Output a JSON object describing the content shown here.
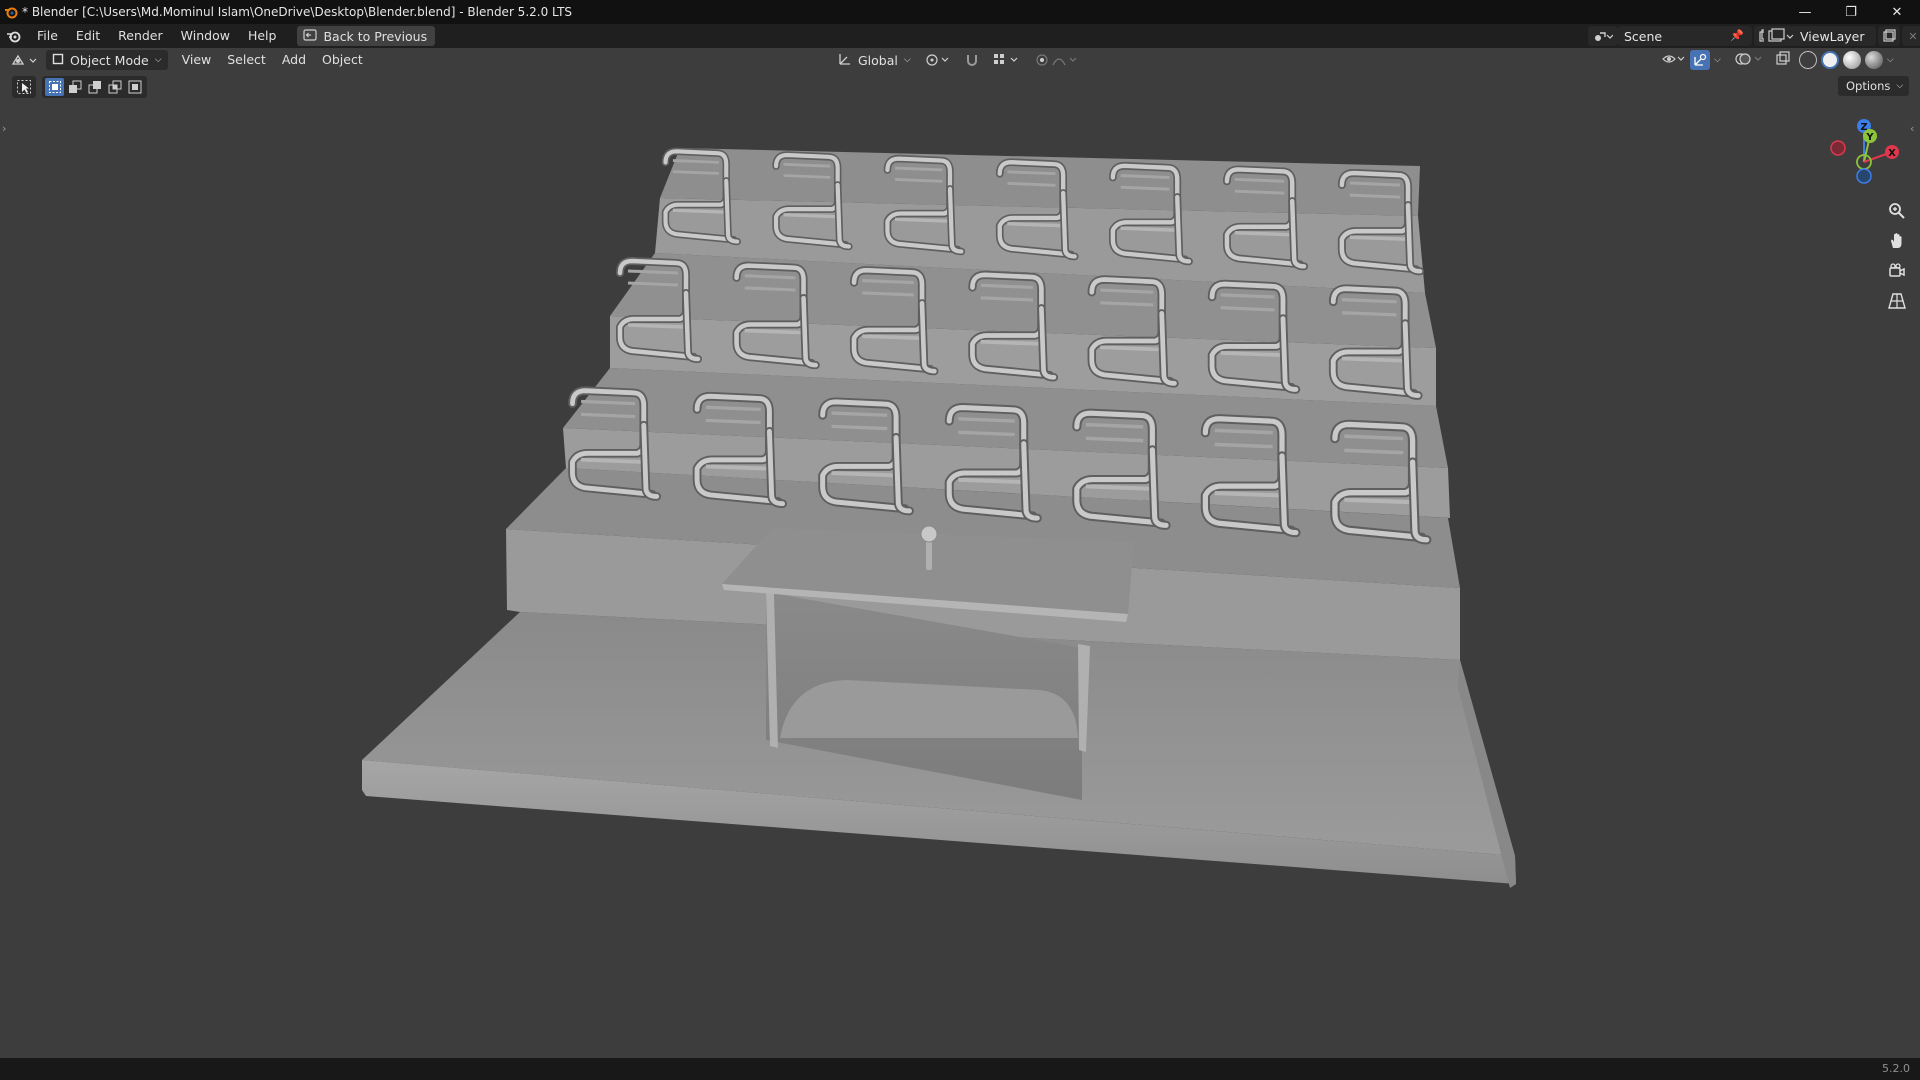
{
  "window": {
    "title": "* Blender [C:\\Users\\Md.Mominul Islam\\OneDrive\\Desktop\\Blender.blend] - Blender 5.2.0 LTS",
    "controls": [
      "minimize-icon",
      "restore-icon",
      "close-icon"
    ]
  },
  "menubar": {
    "items": [
      "File",
      "Edit",
      "Render",
      "Window",
      "Help"
    ],
    "back_button": "Back to Previous",
    "scene_label": "Scene",
    "view_layer_label": "ViewLayer"
  },
  "viewport_header": {
    "mode": "Object Mode",
    "menus": [
      "View",
      "Select",
      "Add",
      "Object"
    ],
    "transform_orientation": "Global",
    "options_label": "Options"
  },
  "gizmo": {
    "axes": [
      "Z",
      "Y",
      "X"
    ]
  },
  "colors": {
    "viewport_bg": "#3d3d3d",
    "accent": "#4772b3",
    "axis_x": "#e0364e",
    "axis_y": "#8cc43a",
    "axis_z": "#3d7ee8",
    "model": "#9b9b9b"
  },
  "scene": {
    "chair_rows": 3,
    "chairs_per_row": 7,
    "objects": [
      "stepped-platform",
      "desk",
      "microphone",
      "chairs"
    ]
  },
  "statusbar": {
    "version": "5.2.0"
  }
}
